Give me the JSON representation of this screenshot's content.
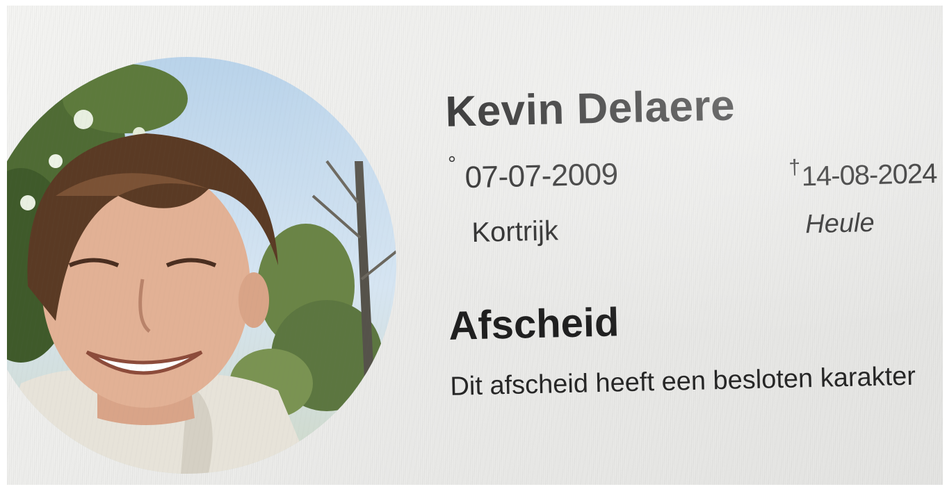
{
  "profile": {
    "name": "Kevin Delaere",
    "born": {
      "symbol": "°",
      "date": "07-07-2009",
      "place": "Kortrijk"
    },
    "died": {
      "symbol": "†",
      "date": "14-08-2024",
      "place": "Heule"
    }
  },
  "farewell": {
    "title": "Afscheid",
    "text": "Dit afscheid heeft een besloten karakter"
  },
  "photo": {
    "icon": "portrait-photo"
  }
}
